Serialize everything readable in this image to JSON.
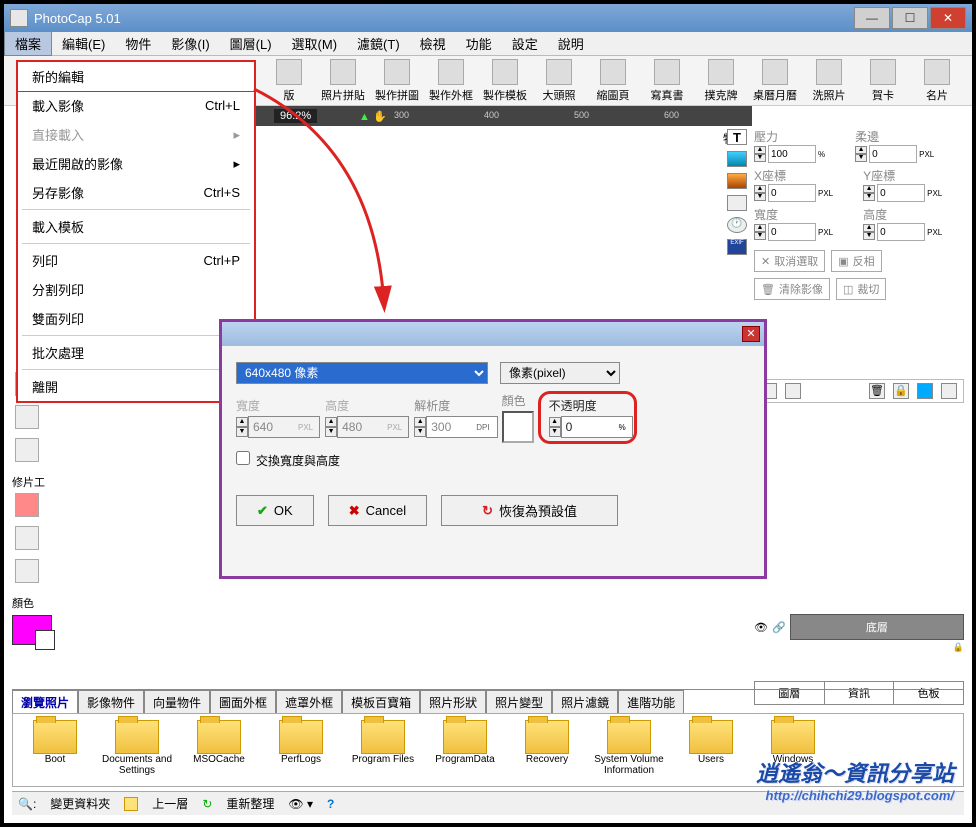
{
  "window": {
    "title": "PhotoCap 5.01"
  },
  "menubar": [
    "檔案",
    "編輯(E)",
    "物件",
    "影像(I)",
    "圖層(L)",
    "選取(M)",
    "濾鏡(T)",
    "檢視",
    "功能",
    "設定",
    "說明"
  ],
  "toolbar": [
    {
      "label": "版"
    },
    {
      "label": "照片拼貼"
    },
    {
      "label": "製作拼圖"
    },
    {
      "label": "製作外框"
    },
    {
      "label": "製作模板"
    },
    {
      "label": "大頭照"
    },
    {
      "label": "縮圖頁"
    },
    {
      "label": "寫真書"
    },
    {
      "label": "撲克牌"
    },
    {
      "label": "桌曆月曆"
    },
    {
      "label": "洗照片"
    },
    {
      "label": "賀卡"
    },
    {
      "label": "名片"
    }
  ],
  "zoom": "96.2%",
  "ruler_marks": [
    "300",
    "400",
    "500",
    "600"
  ],
  "filemenu": [
    {
      "label": "新的編輯",
      "shortcut": "",
      "hl": true
    },
    {
      "label": "載入影像",
      "shortcut": "Ctrl+L"
    },
    {
      "label": "直接載入",
      "shortcut": "",
      "dis": true,
      "sub": true
    },
    {
      "label": "最近開啟的影像",
      "shortcut": "",
      "sub": true
    },
    {
      "label": "另存影像",
      "shortcut": "Ctrl+S"
    },
    {
      "sep": true
    },
    {
      "label": "載入模板",
      "shortcut": ""
    },
    {
      "sep": true
    },
    {
      "label": "列印",
      "shortcut": "Ctrl+P"
    },
    {
      "label": "分割列印",
      "shortcut": ""
    },
    {
      "label": "雙面列印",
      "shortcut": ""
    },
    {
      "sep": true
    },
    {
      "label": "批次處理",
      "shortcut": ""
    },
    {
      "sep": true
    },
    {
      "label": "離開",
      "shortcut": ""
    }
  ],
  "left_tools_title": "修片工",
  "color_title": "顏色",
  "right_panel": {
    "pressure_lbl": "壓力",
    "soft_lbl": "柔邊",
    "pressure_val": "100",
    "soft_val": "0",
    "x_lbl": "X座標",
    "y_lbl": "Y座標",
    "x_val": "0",
    "y_val": "0",
    "w_lbl": "寬度",
    "h_lbl": "高度",
    "w_val": "0",
    "h_val": "0",
    "cancel_sel": "取消選取",
    "invert": "反相",
    "clear_img": "清除影像",
    "crop": "裁切",
    "unit": "PXL",
    "pct": "%"
  },
  "col_label": "物件",
  "dialog": {
    "preset_selected": "640x480 像素",
    "unit_selected": "像素(pixel)",
    "width_lbl": "寬度",
    "height_lbl": "高度",
    "res_lbl": "解析度",
    "color_lbl": "顏色",
    "opacity_lbl": "不透明度",
    "width_val": "640",
    "height_val": "480",
    "res_val": "300",
    "opacity_val": "0",
    "w_unit": "PXL",
    "h_unit": "PXL",
    "res_unit": "DPI",
    "op_unit": "%",
    "swap": "交換寬度與高度",
    "ok": "OK",
    "cancel": "Cancel",
    "reset": "恢復為預設值"
  },
  "bottom_tabs": [
    "瀏覽照片",
    "影像物件",
    "向量物件",
    "圖面外框",
    "遮罩外框",
    "模板百寶箱",
    "照片形狀",
    "照片變型",
    "照片濾鏡",
    "進階功能"
  ],
  "folders": [
    "Boot",
    "Documents and Settings",
    "MSOCache",
    "PerfLogs",
    "Program Files",
    "ProgramData",
    "Recovery",
    "System Volume Information",
    "Users",
    "Windows"
  ],
  "statusbar": {
    "change": "變更資料夾",
    "up": "上一層",
    "refresh": "重新整理"
  },
  "layers": {
    "base": "底層",
    "tabs": [
      "圖層",
      "資訊",
      "色板"
    ]
  },
  "watermark": {
    "title": "逍遙翁～資訊分享站",
    "url": "http://chihchi29.blogspot.com/"
  }
}
